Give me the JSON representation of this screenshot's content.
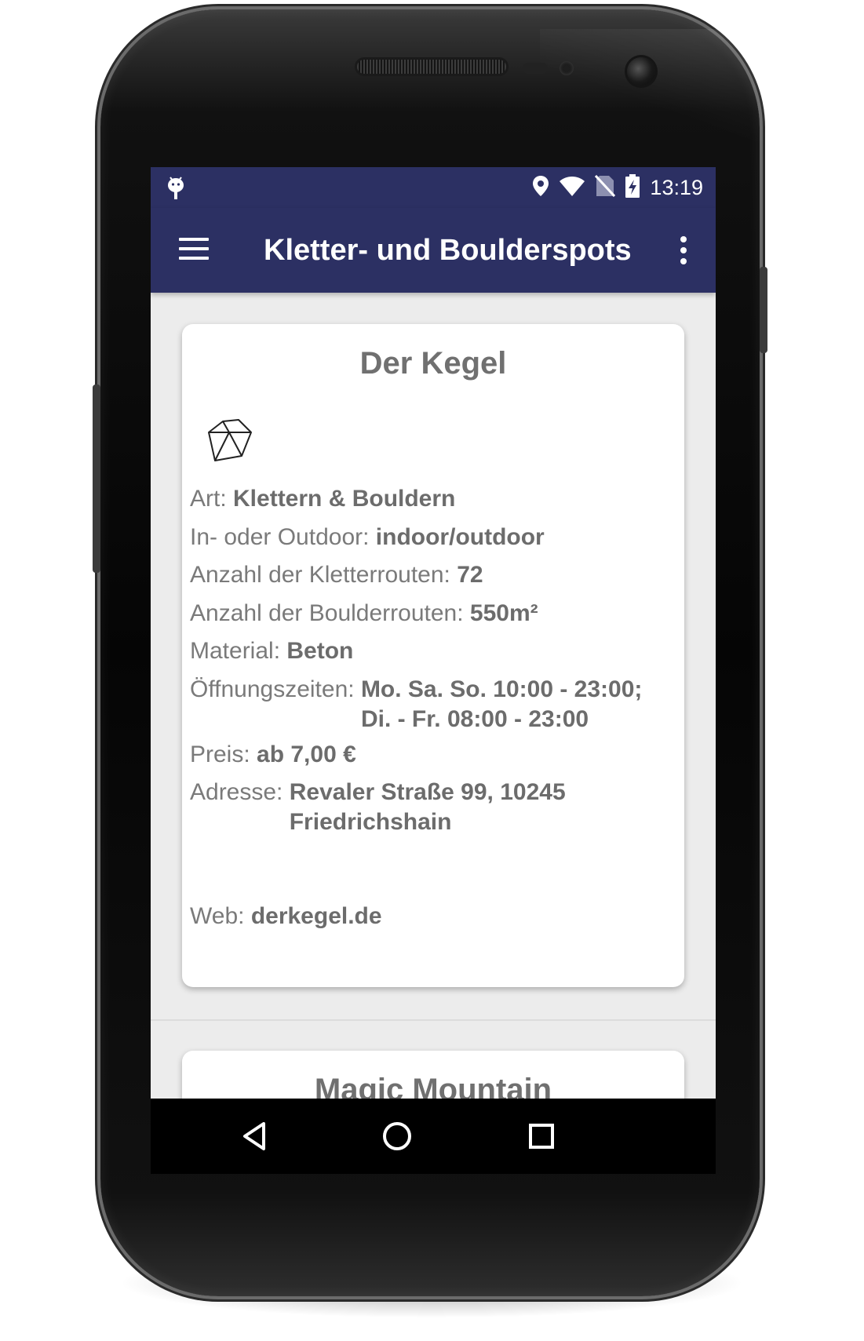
{
  "status_bar": {
    "time": "13:19",
    "icons": [
      "android-notification-icon",
      "location-pin-icon",
      "wifi-icon",
      "no-sim-icon",
      "battery-charging-icon"
    ]
  },
  "app_bar": {
    "title": "Kletter- und Boulderspots",
    "icons": [
      "menu-icon",
      "more-vert-icon"
    ]
  },
  "colors": {
    "primary": "#2c3063",
    "background": "#ececec",
    "card": "#ffffff",
    "label_text": "#7a7a7a",
    "value_text": "#6c6c6c"
  },
  "spots": [
    {
      "name": "Der Kegel",
      "icon": "boulder-rock-icon",
      "fields": [
        {
          "label": "Art: ",
          "value": "Klettern & Bouldern"
        },
        {
          "label": "In- oder Outdoor: ",
          "value": "indoor/outdoor"
        },
        {
          "label": "Anzahl der Kletterrouten: ",
          "value": "72"
        },
        {
          "label": "Anzahl der Boulderrouten: ",
          "value": "550m²"
        },
        {
          "label": "Material: ",
          "value": "Beton"
        },
        {
          "label": "Öffnungszeiten: ",
          "value_lines": [
            "Mo. Sa. So. 10:00 - 23:00;",
            "Di. - Fr. 08:00 - 23:00"
          ]
        },
        {
          "label": "Preis: ",
          "value": "ab 7,00 €"
        },
        {
          "label": "Adresse: ",
          "value_lines": [
            "Revaler Straße 99, 10245",
            "Friedrichshain"
          ]
        },
        {
          "label": "Web: ",
          "value": "derkegel.de"
        }
      ]
    },
    {
      "name": "Magic Mountain"
    }
  ],
  "nav_bar": {
    "icons": [
      "back-icon",
      "home-icon",
      "recents-icon"
    ]
  }
}
